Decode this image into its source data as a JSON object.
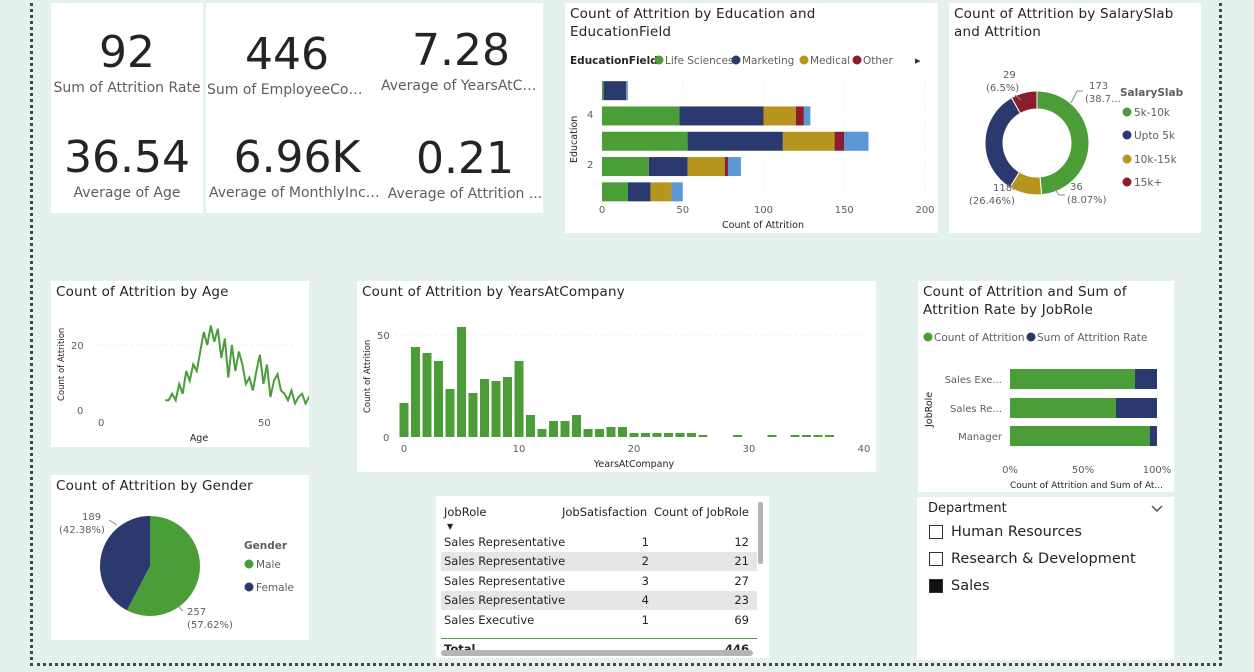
{
  "kpis": [
    {
      "value": "92",
      "label": "Sum of Attrition Rate"
    },
    {
      "value": "446",
      "label": "Sum of EmployeeCount"
    },
    {
      "value": "7.28",
      "label": "Average of YearsAtCo..."
    },
    {
      "value": "36.54",
      "label": "Average of Age"
    },
    {
      "value": "6.96K",
      "label": "Average of MonthlyInco..."
    },
    {
      "value": "0.21",
      "label": "Average of Attrition ..."
    }
  ],
  "colors": {
    "green": "#4a9d37",
    "navy": "#2b3a6e",
    "gold": "#b7951f",
    "maroon": "#8b1e2c",
    "blue": "#5b96d6"
  },
  "edu_chart": {
    "title": "Count of Attrition by Education and EducationField",
    "legend_title": "EducationField",
    "legend": [
      "Life Sciences",
      "Marketing",
      "Medical",
      "Other"
    ],
    "y_label": "Education",
    "y_ticks": [
      "4",
      "2"
    ],
    "x_label": "Count of Attrition",
    "x_ticks": [
      "0",
      "50",
      "100",
      "150",
      "200"
    ],
    "more_icon": "▸"
  },
  "salary_chart": {
    "title": "Count of Attrition by SalarySlab and Attrition",
    "legend_title": "SalarySlab",
    "legend": [
      "5k-10k",
      "Upto 5k",
      "10k-15k",
      "15k+"
    ],
    "labels": [
      {
        "value": "173",
        "pct": "(38.7..."
      },
      {
        "value": "36",
        "pct": "(8.07%)"
      },
      {
        "value": "118",
        "pct": "(26.46%)"
      },
      {
        "value": "29",
        "pct": "(6.5%)"
      }
    ]
  },
  "age_chart": {
    "title": "Count of Attrition by Age",
    "y_label": "Count of Attrition",
    "x_label": "Age",
    "y_ticks": [
      "20",
      "0"
    ],
    "x_ticks": [
      "0",
      "50"
    ]
  },
  "years_chart": {
    "title": "Count of Attrition by YearsAtCompany",
    "y_label": "Count of Attrition",
    "x_label": "YearsAtCompany",
    "y_ticks": [
      "50",
      "0"
    ],
    "x_ticks": [
      "0",
      "10",
      "20",
      "30",
      "40"
    ]
  },
  "jobrole_chart": {
    "title": "Count of Attrition and Sum of Attrition Rate by JobRole",
    "legend": [
      "Count of Attrition",
      "Sum of Attrition Rate"
    ],
    "y_label": "JobRole",
    "roles": [
      "Sales Exe...",
      "Sales Re...",
      "Manager"
    ],
    "x_ticks": [
      "0%",
      "50%",
      "100%"
    ],
    "x_label": "Count of Attrition and Sum of At..."
  },
  "gender_chart": {
    "title": "Count of Attrition by Gender",
    "legend_title": "Gender",
    "legend": [
      "Male",
      "Female"
    ],
    "labels": [
      {
        "value": "189",
        "pct": "(42.38%)"
      },
      {
        "value": "257",
        "pct": "(57.62%)"
      }
    ]
  },
  "table": {
    "headers": [
      "JobRole",
      "JobSatisfaction",
      "Count of JobRole"
    ],
    "rows": [
      [
        "Sales Representative",
        "1",
        "12"
      ],
      [
        "Sales Representative",
        "2",
        "21"
      ],
      [
        "Sales Representative",
        "3",
        "27"
      ],
      [
        "Sales Representative",
        "4",
        "23"
      ],
      [
        "Sales Executive",
        "1",
        "69"
      ]
    ],
    "total_label": "Total",
    "total_value": "446"
  },
  "slicer": {
    "title": "Department",
    "items": [
      {
        "label": "Human Resources",
        "checked": false
      },
      {
        "label": "Research & Development",
        "checked": false
      },
      {
        "label": "Sales",
        "checked": true
      }
    ]
  },
  "chart_data": [
    {
      "type": "bar",
      "orientation": "horizontal",
      "stacked": true,
      "title": "Count of Attrition by Education and EducationField",
      "xlabel": "Count of Attrition",
      "ylabel": "Education",
      "xlim": [
        0,
        200
      ],
      "categories": [
        "5",
        "4",
        "3",
        "2",
        "1"
      ],
      "series": [
        {
          "name": "Life Sciences",
          "values": [
            1,
            48,
            53,
            29,
            16
          ]
        },
        {
          "name": "Marketing",
          "values": [
            14,
            52,
            59,
            24,
            14
          ]
        },
        {
          "name": "Medical",
          "values": [
            0,
            20,
            32,
            23,
            13
          ]
        },
        {
          "name": "Other",
          "values": [
            0,
            5,
            6,
            2,
            0
          ]
        },
        {
          "name": "",
          "values": [
            1,
            4,
            15,
            8,
            7
          ]
        }
      ]
    },
    {
      "type": "pie",
      "donut": true,
      "title": "Count of Attrition by SalarySlab and Attrition",
      "categories": [
        "5k-10k",
        "Upto 5k",
        "10k-15k",
        "15k+"
      ],
      "values": [
        173,
        118,
        36,
        29
      ]
    },
    {
      "type": "line",
      "title": "Count of Attrition by Age",
      "xlabel": "Age",
      "ylabel": "Count of Attrition",
      "xlim": [
        0,
        60
      ],
      "ylim": [
        0,
        28
      ],
      "x": [
        18,
        19,
        20,
        21,
        22,
        23,
        24,
        25,
        26,
        27,
        28,
        29,
        30,
        31,
        32,
        33,
        34,
        35,
        36,
        37,
        38,
        39,
        40,
        41,
        42,
        43,
        44,
        45,
        46,
        47,
        48,
        49,
        50,
        51,
        52,
        53,
        54,
        55,
        56,
        57,
        58,
        59,
        60
      ],
      "values": [
        3,
        3,
        5,
        3,
        8,
        5,
        12,
        9,
        14,
        12,
        18,
        24,
        20,
        26,
        21,
        25,
        16,
        22,
        10,
        20,
        12,
        18,
        14,
        8,
        10,
        6,
        12,
        17,
        8,
        14,
        4,
        9,
        11,
        6,
        5,
        3,
        6,
        2,
        4,
        5,
        2,
        4,
        3
      ]
    },
    {
      "type": "bar",
      "title": "Count of Attrition by YearsAtCompany",
      "xlabel": "YearsAtCompany",
      "ylabel": "Count of Attrition",
      "xlim": [
        -1,
        40
      ],
      "ylim": [
        0,
        58
      ],
      "x": [
        0,
        1,
        2,
        3,
        4,
        5,
        6,
        7,
        8,
        9,
        10,
        11,
        12,
        13,
        14,
        15,
        16,
        17,
        18,
        19,
        20,
        21,
        22,
        23,
        24,
        25,
        26,
        29,
        32,
        34,
        35,
        36,
        37
      ],
      "values": [
        17,
        45,
        42,
        38,
        24,
        55,
        22,
        29,
        28,
        30,
        38,
        11,
        4,
        8,
        8,
        11,
        4,
        4,
        5,
        5,
        2,
        2,
        2,
        2,
        2,
        2,
        1,
        1,
        1,
        1,
        1,
        1,
        1
      ]
    },
    {
      "type": "bar",
      "orientation": "horizontal",
      "stacked": true,
      "percent": true,
      "title": "Count of Attrition and Sum of Attrition Rate by JobRole",
      "xlabel": "Count of Attrition and Sum of At...",
      "ylabel": "JobRole",
      "categories": [
        "Sales Exe...",
        "Sales Re...",
        "Manager"
      ],
      "series": [
        {
          "name": "Count of Attrition",
          "values": [
            85,
            72,
            95
          ]
        },
        {
          "name": "Sum of Attrition Rate",
          "values": [
            15,
            28,
            5
          ]
        }
      ]
    },
    {
      "type": "pie",
      "title": "Count of Attrition by Gender",
      "categories": [
        "Male",
        "Female"
      ],
      "values": [
        257,
        189
      ]
    }
  ]
}
